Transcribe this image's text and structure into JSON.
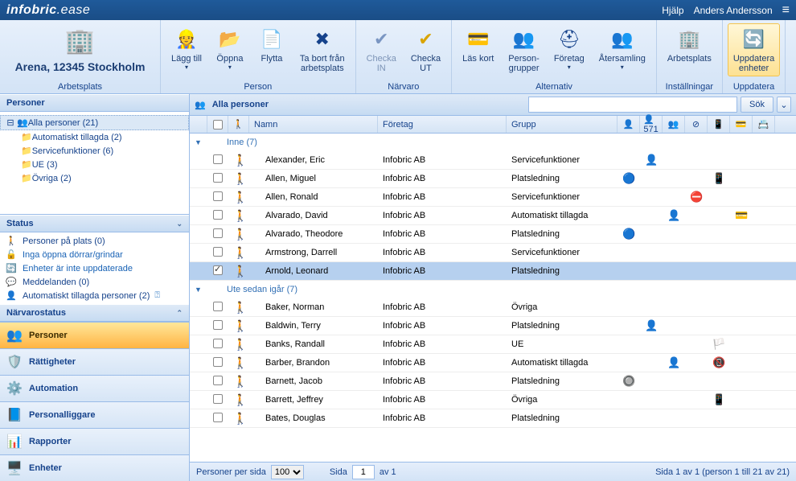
{
  "top": {
    "brand1": "infobric",
    "brand2": ".ease",
    "help": "Hjälp",
    "user": "Anders Andersson"
  },
  "site": {
    "name": "Arena, 12345 Stockholm",
    "caption": "Arbetsplats"
  },
  "ribbon": {
    "person_caption": "Person",
    "add": "Lägg till",
    "open": "Öppna",
    "move": "Flytta",
    "remove": "Ta bort från\narbetsplats",
    "narvaro_caption": "Närvaro",
    "checkin": "Checka\nIN",
    "checkout": "Checka\nUT",
    "alt_caption": "Alternativ",
    "readcard": "Läs kort",
    "pgroups": "Person-\ngrupper",
    "company": "Företag",
    "assembly": "Återsamling",
    "settings_caption": "Inställningar",
    "workplace": "Arbetsplats",
    "update_caption": "Uppdatera",
    "update_units": "Uppdatera\nenheter"
  },
  "left": {
    "personer_hdr": "Personer",
    "tree": {
      "all": "Alla personer (21)",
      "auto": "Automatiskt tillagda (2)",
      "svc": "Servicefunktioner (6)",
      "ue": "UE (3)",
      "ovriga": "Övriga (2)"
    },
    "status_hdr": "Status",
    "status": {
      "onsite": "Personer på plats (0)",
      "doors": "Inga öppna dörrar/grindar",
      "units": "Enheter är inte uppdaterade",
      "msgs": "Meddelanden (0)",
      "auto": "Automatiskt tillagda personer (2)"
    },
    "narvaro_hdr": "Närvarostatus",
    "nav": {
      "personer": "Personer",
      "ratt": "Rättigheter",
      "auto": "Automation",
      "pl": "Personalliggare",
      "rap": "Rapporter",
      "enh": "Enheter"
    }
  },
  "grid": {
    "title": "Alla personer",
    "search_btn": "Sök",
    "cols": {
      "name": "Namn",
      "company": "Företag",
      "group": "Grupp"
    },
    "grp_inne": "Inne (7)",
    "grp_ute": "Ute sedan igår (7)",
    "rows_inne": [
      {
        "name": "Alexander, Eric",
        "company": "Infobric AB",
        "group": "Servicefunktioner",
        "i2": "👤"
      },
      {
        "name": "Allen, Miguel",
        "company": "Infobric AB",
        "group": "Platsledning",
        "i1": "🔵",
        "i5": "📱"
      },
      {
        "name": "Allen, Ronald",
        "company": "Infobric AB",
        "group": "Servicefunktioner",
        "i4": "⛔"
      },
      {
        "name": "Alvarado, David",
        "company": "Infobric AB",
        "group": "Automatiskt tillagda",
        "i3": "👤",
        "i6": "💳"
      },
      {
        "name": "Alvarado, Theodore",
        "company": "Infobric AB",
        "group": "Platsledning",
        "i1": "🔵"
      },
      {
        "name": "Armstrong, Darrell",
        "company": "Infobric AB",
        "group": "Servicefunktioner"
      },
      {
        "name": "Arnold, Leonard",
        "company": "Infobric AB",
        "group": "Platsledning",
        "checked": true,
        "sel": true
      }
    ],
    "rows_ute": [
      {
        "name": "Baker, Norman",
        "company": "Infobric AB",
        "group": "Övriga"
      },
      {
        "name": "Baldwin, Terry",
        "company": "Infobric AB",
        "group": "Platsledning",
        "i2": "👤"
      },
      {
        "name": "Banks, Randall",
        "company": "Infobric AB",
        "group": "UE",
        "i5": "🏳️"
      },
      {
        "name": "Barber, Brandon",
        "company": "Infobric AB",
        "group": "Automatiskt tillagda",
        "i3": "👤",
        "i5": "📵"
      },
      {
        "name": "Barnett, Jacob",
        "company": "Infobric AB",
        "group": "Platsledning",
        "i1": "🔘"
      },
      {
        "name": "Barrett, Jeffrey",
        "company": "Infobric AB",
        "group": "Övriga",
        "i5": "📱"
      },
      {
        "name": "Bates, Douglas",
        "company": "Infobric AB",
        "group": "Platsledning"
      }
    ]
  },
  "pager": {
    "per_page_label": "Personer per sida",
    "per_page_val": "100",
    "page_label": "Sida",
    "page_val": "1",
    "of_label": "av 1",
    "info": "Sida 1 av 1 (person 1 till 21 av 21)"
  }
}
